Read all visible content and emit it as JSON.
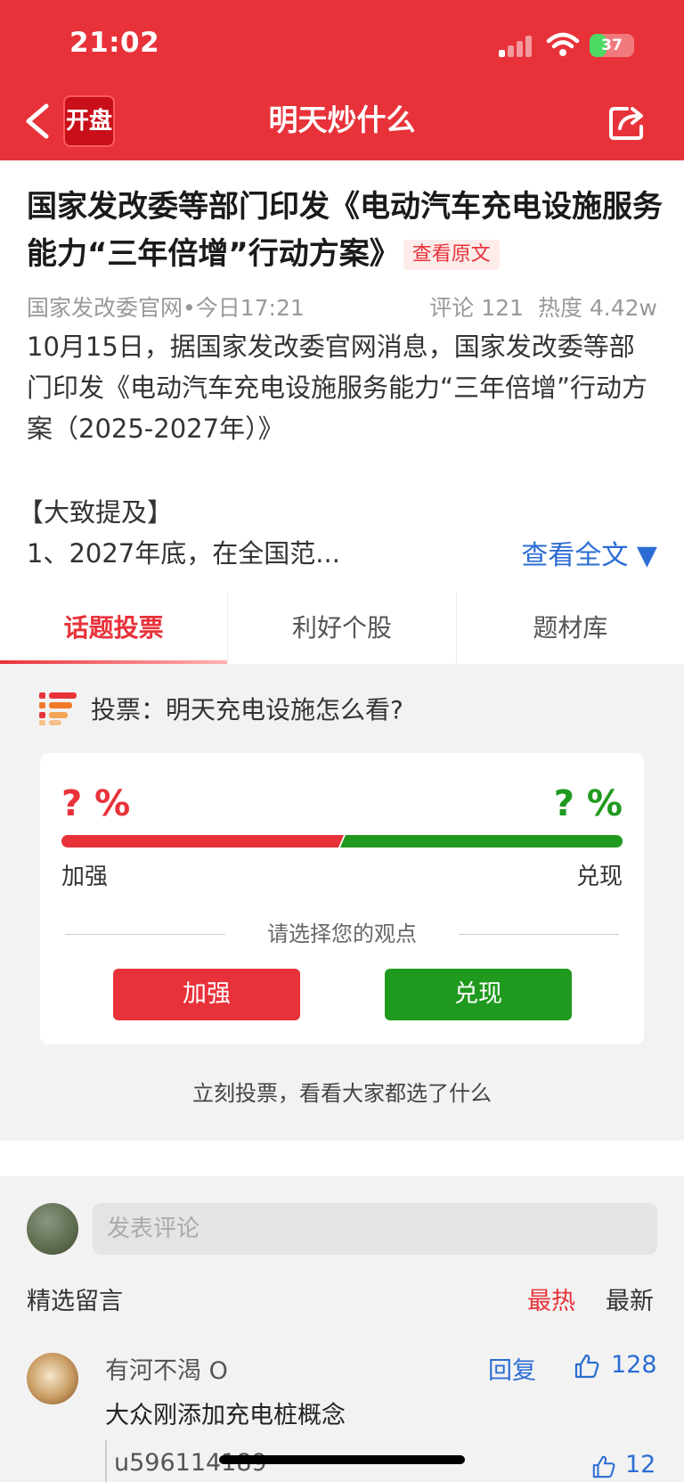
{
  "status_bar": {
    "time": "21:02",
    "battery": "37"
  },
  "nav": {
    "logo_text": "开盘",
    "title": "明天炒什么",
    "back_icon": "chevron-left-icon",
    "share_icon": "share-icon"
  },
  "article": {
    "headline": "国家发改委等部门印发《电动汽车充电设施服务能力“三年倍增”行动方案》",
    "view_original": "查看原文",
    "source_time": "国家发改委官网•今日17:21",
    "comments": "评论 121",
    "heat": "热度 4.42w",
    "summary": "10月15日，据国家发改委官网消息，国家发改委等部门印发《电动汽车充电设施服务能力“三年倍增”行动方案（2025-2027年）》",
    "mention_title": "【大致提及】",
    "mention_item": "1、2027年底，在全国范...",
    "view_full": "查看全文 ▼"
  },
  "tabs": [
    {
      "label": "话题投票",
      "active": true
    },
    {
      "label": "利好个股",
      "active": false
    },
    {
      "label": "题材库",
      "active": false
    }
  ],
  "vote": {
    "question": "投票：明天充电设施怎么看?",
    "left_pct": "? %",
    "right_pct": "? %",
    "left_share": 0.5,
    "left_label": "加强",
    "right_label": "兑现",
    "choose_text": "请选择您的观点",
    "btn_strong": "加强",
    "btn_cash": "兑现",
    "prompt": "立刻投票，看看大家都选了什么",
    "colors": {
      "strong": "#e8323a",
      "cash": "#1f9a1f"
    }
  },
  "comments": {
    "input_placeholder": "发表评论",
    "featured_label": "精选留言",
    "sort_hot": "最热",
    "sort_new": "最新",
    "items": [
      {
        "user": "有河不渴 O",
        "reply_label": "回复",
        "likes": "128",
        "text": "大众刚添加充电桩概念",
        "replies": [
          {
            "user": "u596114189",
            "likes": "12"
          }
        ]
      }
    ]
  }
}
